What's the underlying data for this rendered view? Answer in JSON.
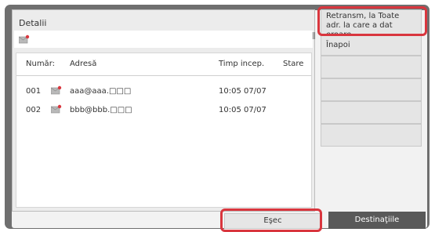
{
  "panel": {
    "title": "Detalii"
  },
  "table": {
    "headers": {
      "number": "Număr:",
      "address": "Adresă",
      "start_time": "Timp incep.",
      "status": "Stare"
    },
    "rows": [
      {
        "number": "001",
        "address": "aaa@aaa.□□□",
        "start_time": "10:05 07/07",
        "status": "",
        "icon": "mail-error-icon"
      },
      {
        "number": "002",
        "address": "bbb@bbb.□□□",
        "start_time": "10:05 07/07",
        "status": "",
        "icon": "mail-error-icon"
      }
    ]
  },
  "side_menu": {
    "retransmit_label": "Retransm, la Toate adr. la care a dat eroare",
    "back_label": "Înapoi"
  },
  "footer": {
    "fail_label": "Eşec",
    "destinations_label": "Destinaţiile"
  },
  "colors": {
    "highlight": "#d9363e",
    "dark_button": "#595959",
    "frame": "#6f6f6f"
  }
}
